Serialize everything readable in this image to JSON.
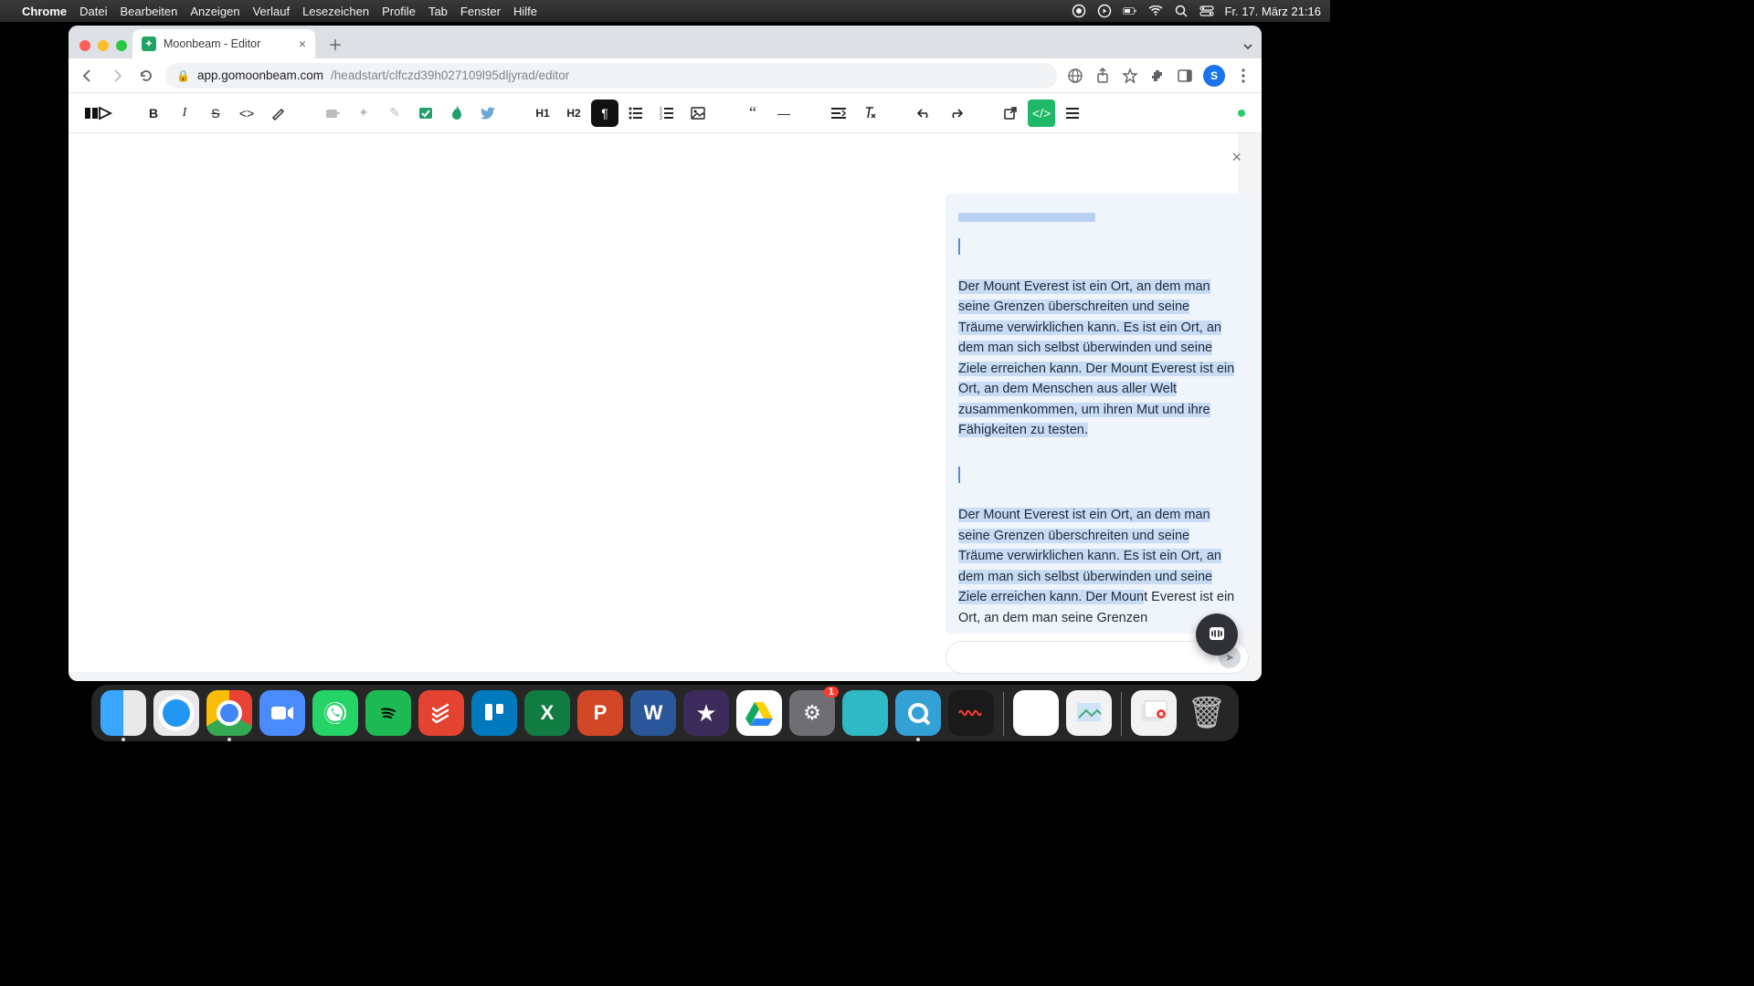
{
  "menubar": {
    "app": "Chrome",
    "items": [
      "Datei",
      "Bearbeiten",
      "Anzeigen",
      "Verlauf",
      "Lesezeichen",
      "Profile",
      "Tab",
      "Fenster",
      "Hilfe"
    ],
    "date": "Fr. 17. März  21:16"
  },
  "tab": {
    "title": "Moonbeam - Editor"
  },
  "url": {
    "host": "app.gomoonbeam.com",
    "path": "/headstart/clfczd39h027109l95dljyrad/editor"
  },
  "avatar_letter": "S",
  "toolbar": {
    "h1": "H1",
    "h2": "H2"
  },
  "ai_panel": {
    "para1": "Der Mount Everest ist ein Ort, an dem man seine Grenzen überschreiten und seine Träume verwirklichen kann. Es ist ein Ort, an dem man sich selbst überwinden und seine Ziele erreichen kann. Der Mount Everest ist ein Ort, an dem Menschen aus aller Welt zusammenkommen, um ihren Mut und ihre Fähigkeiten zu testen.",
    "para2_hl": "Der Mount Everest ist ein Ort, an dem man seine Grenzen überschreiten und seine Träume verwirklichen kann. Es ist ein Ort, an dem man sich selbst überwinden und seine Ziele erreichen kann. Der Moun",
    "para2_caret": "t",
    "para2_rest": " Everest ist ein Ort, an dem man seine Grenzen",
    "input_placeholder": ""
  },
  "dock": {
    "badge_settings": "1"
  }
}
